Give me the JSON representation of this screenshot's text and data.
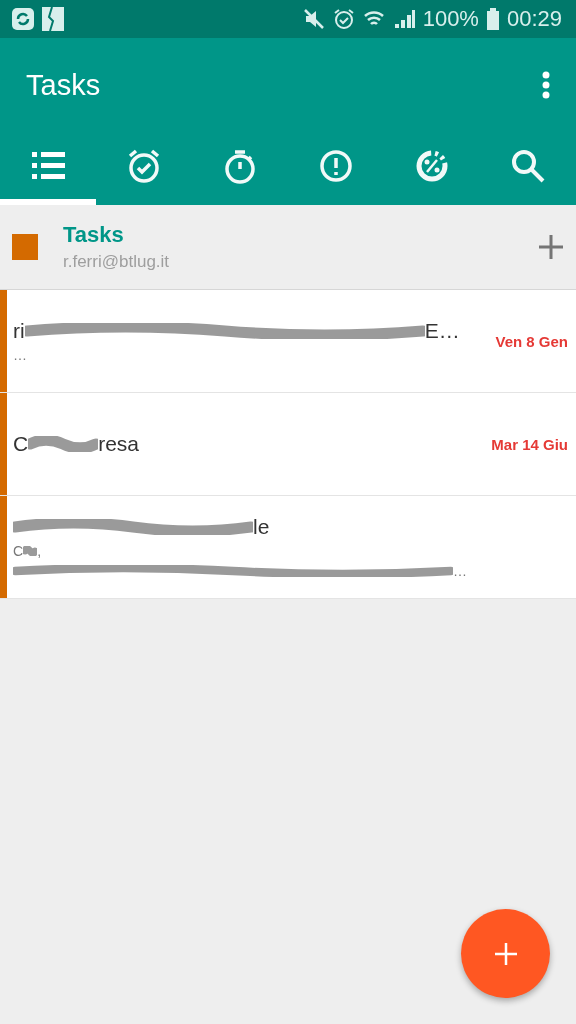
{
  "status_bar": {
    "battery": "100%",
    "time": "00:29"
  },
  "app_bar": {
    "title": "Tasks"
  },
  "tabs": [
    {
      "kind": "list",
      "selected": true
    },
    {
      "kind": "alarm",
      "selected": false
    },
    {
      "kind": "timer",
      "selected": false
    },
    {
      "kind": "priority",
      "selected": false
    },
    {
      "kind": "progress",
      "selected": false
    },
    {
      "kind": "search",
      "selected": false
    }
  ],
  "list_header": {
    "title": "Tasks",
    "account": "r.ferri@btlug.it",
    "color": "#d46a00"
  },
  "tasks": [
    {
      "title_start": "ri",
      "title_end": "E…",
      "note_start": "…",
      "due": "Ven 8 Gen",
      "color": "#d46a00"
    },
    {
      "title_start": "C",
      "title_end": "resa",
      "due": "Mar 14 Giu",
      "color": "#d46a00"
    },
    {
      "title_end": "le",
      "note_start": "C",
      "note_mid": ",",
      "note_end": "…",
      "color": "#d46a00"
    }
  ]
}
